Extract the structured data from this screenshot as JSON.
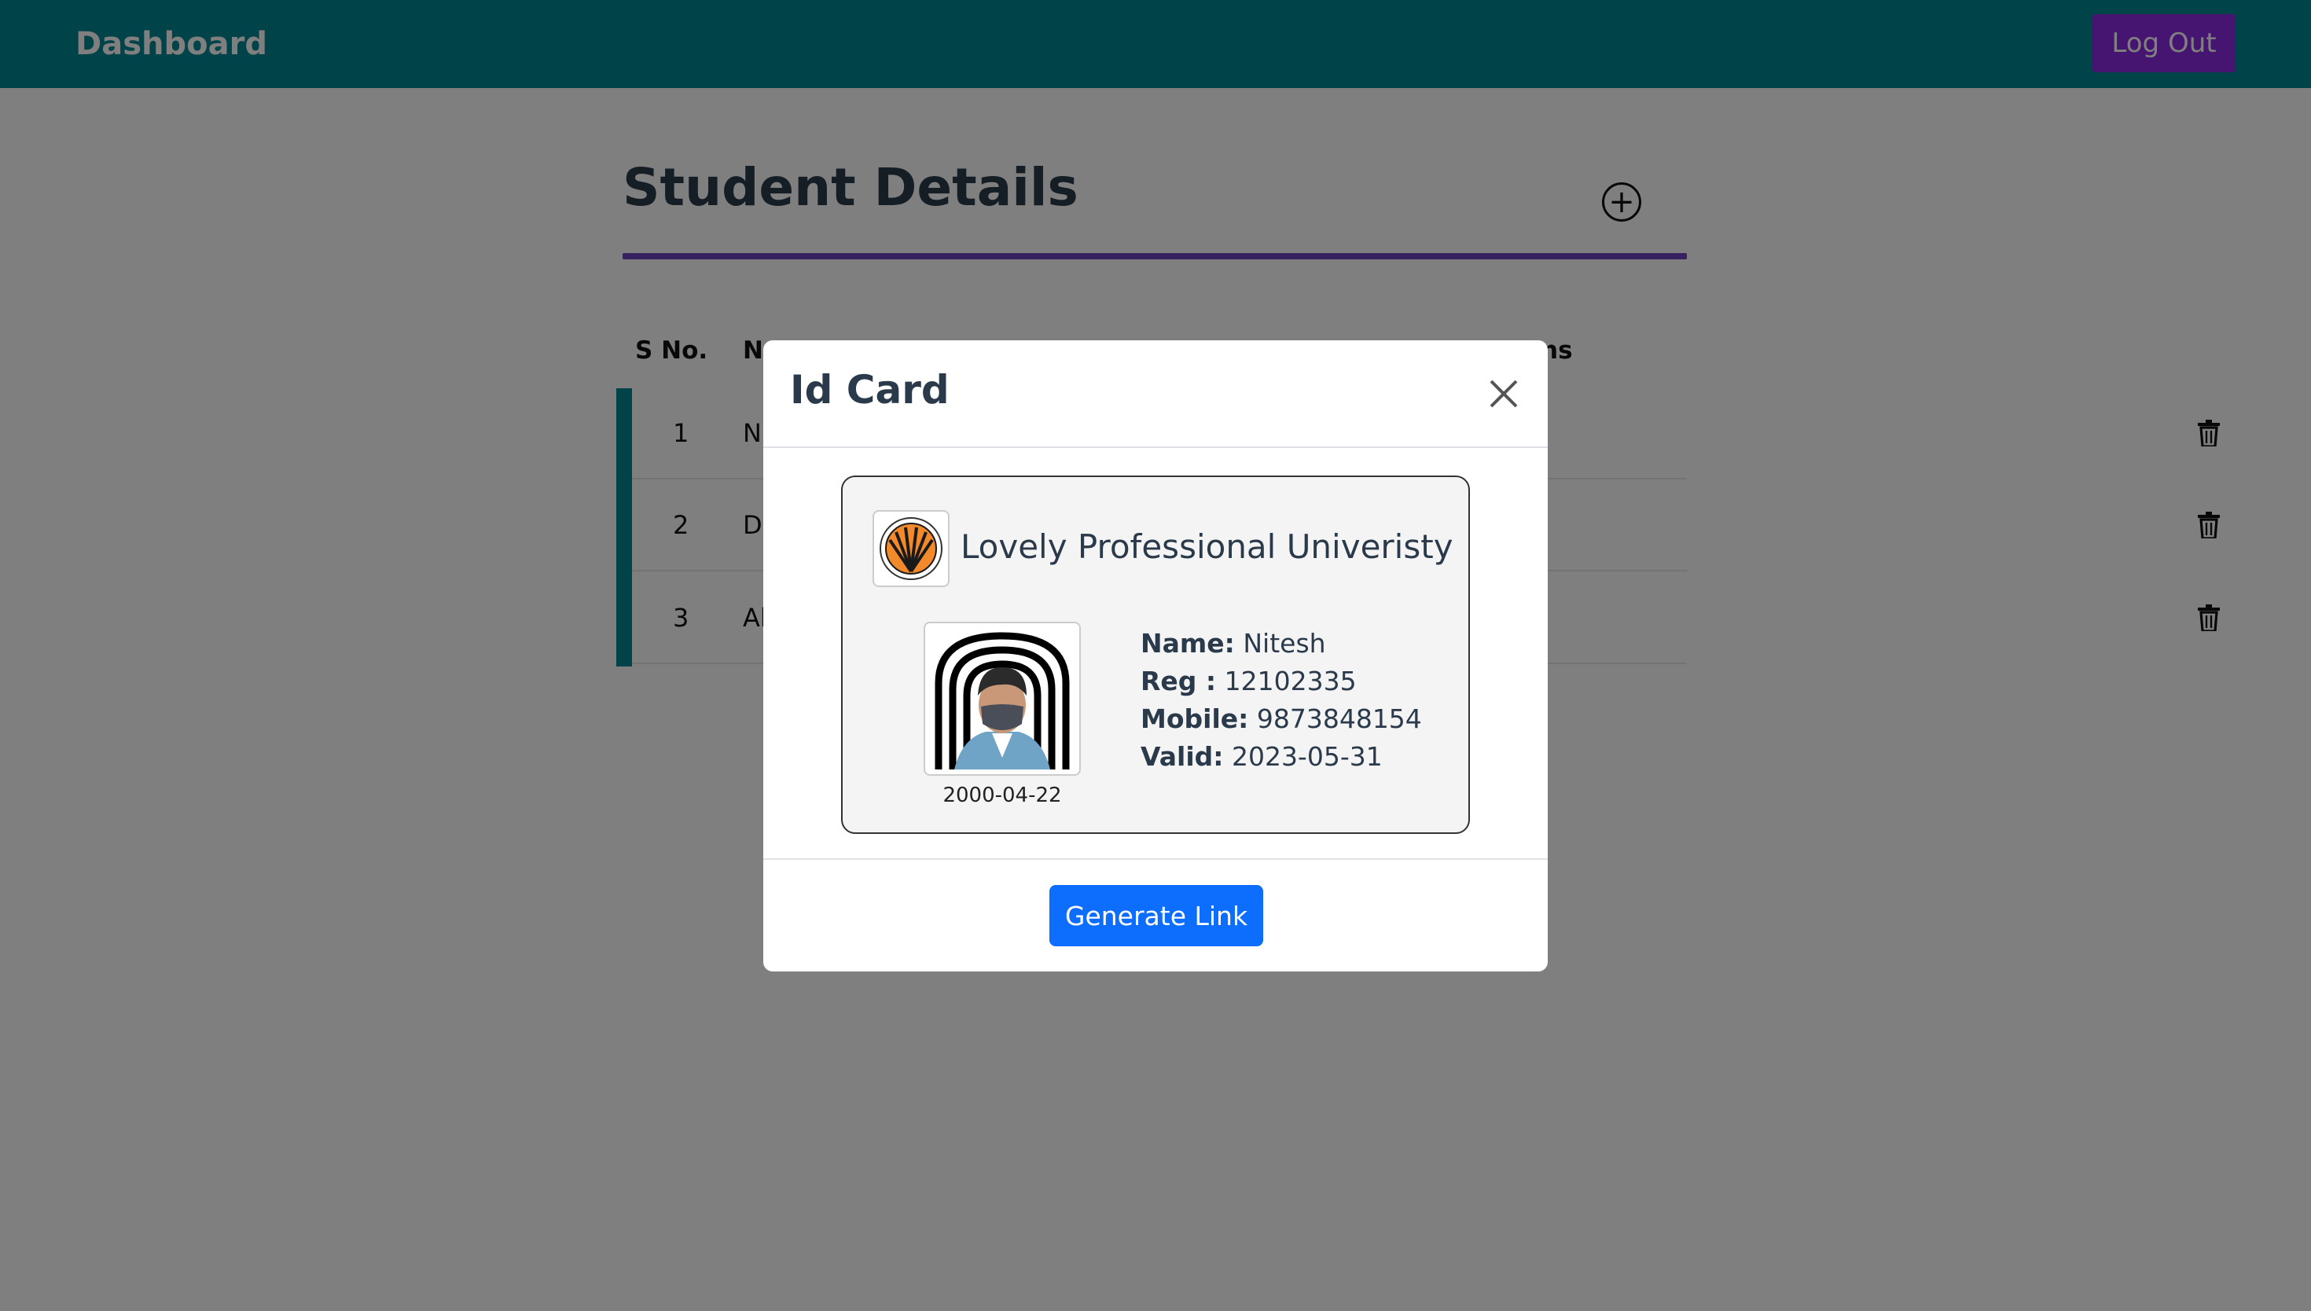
{
  "navbar": {
    "brand": "Dashboard",
    "logout_label": "Log Out"
  },
  "page": {
    "heading": "Student Details",
    "add_icon": "plus-circle-icon"
  },
  "table": {
    "headers": {
      "sno": "S No.",
      "name": "N",
      "actions": "ns"
    },
    "rows": [
      {
        "sno": "1",
        "name": "Ni"
      },
      {
        "sno": "2",
        "name": "De"
      },
      {
        "sno": "3",
        "name": "Al"
      }
    ],
    "row_action_icon": "trash-icon"
  },
  "modal": {
    "title": "Id Card",
    "close_icon": "close-icon",
    "card": {
      "university": "Lovely Professional Univeristy",
      "dob": "2000-04-22",
      "fields": [
        {
          "label": "Name:",
          "value": "Nitesh"
        },
        {
          "label": "Reg :",
          "value": "12102335"
        },
        {
          "label": "Mobile:",
          "value": "9873848154"
        },
        {
          "label": "Valid:",
          "value": "2023-05-31"
        }
      ]
    },
    "generate_label": "Generate Link"
  },
  "colors": {
    "navbar": "#008691",
    "logout": "#8a2be2",
    "heading_rule": "#6f42c1",
    "primary": "#0d6efd"
  }
}
